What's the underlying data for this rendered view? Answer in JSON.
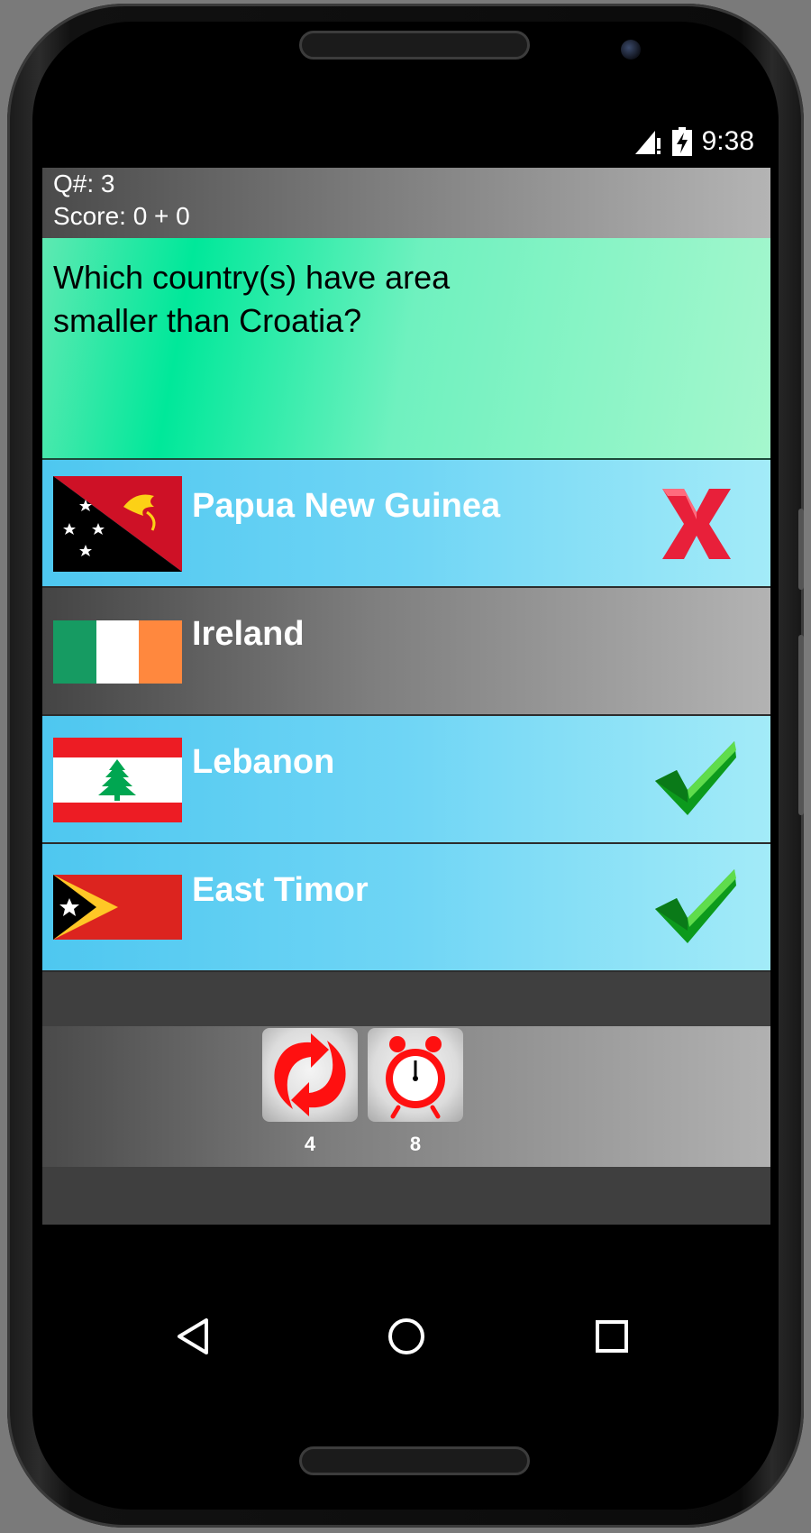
{
  "status_bar": {
    "time": "9:38"
  },
  "header": {
    "question_number": "Q#: 3",
    "score": "Score: 0 + 0"
  },
  "question": {
    "text": "Which country(s) have area smaller than Croatia?"
  },
  "answers": [
    {
      "label": "Papua New Guinea",
      "flag": "papua-new-guinea-flag",
      "result": "wrong"
    },
    {
      "label": "Ireland",
      "flag": "ireland-flag",
      "result": "none"
    },
    {
      "label": "Lebanon",
      "flag": "lebanon-flag",
      "result": "correct"
    },
    {
      "label": "East Timor",
      "flag": "east-timor-flag",
      "result": "correct"
    }
  ],
  "tools": [
    {
      "icon": "refresh-icon",
      "count": "4"
    },
    {
      "icon": "alarm-clock-icon",
      "count": "8"
    }
  ],
  "nav": [
    "back-icon",
    "home-icon",
    "recents-icon"
  ],
  "colors": {
    "question_bg": "#00e89a",
    "answer_blue": "#4ec7f0",
    "correct": "#0c9a1c",
    "wrong": "#e8203a",
    "accent_red": "#ff1010"
  }
}
